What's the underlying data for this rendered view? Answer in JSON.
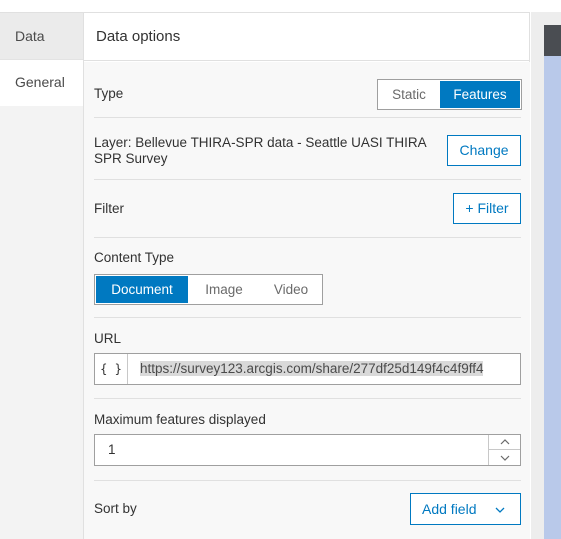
{
  "sidebar": {
    "tabs": [
      {
        "label": "Data"
      },
      {
        "label": "General"
      }
    ]
  },
  "panel": {
    "title": "Data options",
    "type": {
      "label": "Type",
      "options": [
        "Static",
        "Features"
      ],
      "selected": "Features"
    },
    "layer": {
      "label": "Layer: Bellevue THIRA-SPR data - Seattle UASI THIRA SPR Survey",
      "change_button": "Change"
    },
    "filter": {
      "label": "Filter",
      "button": "+ Filter"
    },
    "content_type": {
      "label": "Content Type",
      "options": [
        "Document",
        "Image",
        "Video"
      ],
      "selected": "Document"
    },
    "url": {
      "label": "URL",
      "brace": "{ }",
      "value": "https://survey123.arcgis.com/share/277df25d149f4c4f9ff4"
    },
    "max_features": {
      "label": "Maximum features displayed",
      "value": "1"
    },
    "sort_by": {
      "label": "Sort by",
      "button": "Add field"
    }
  },
  "colors": {
    "accent": "#0079c1",
    "map_blue": "#b9c9ea",
    "map_dark": "#4a4d52"
  }
}
